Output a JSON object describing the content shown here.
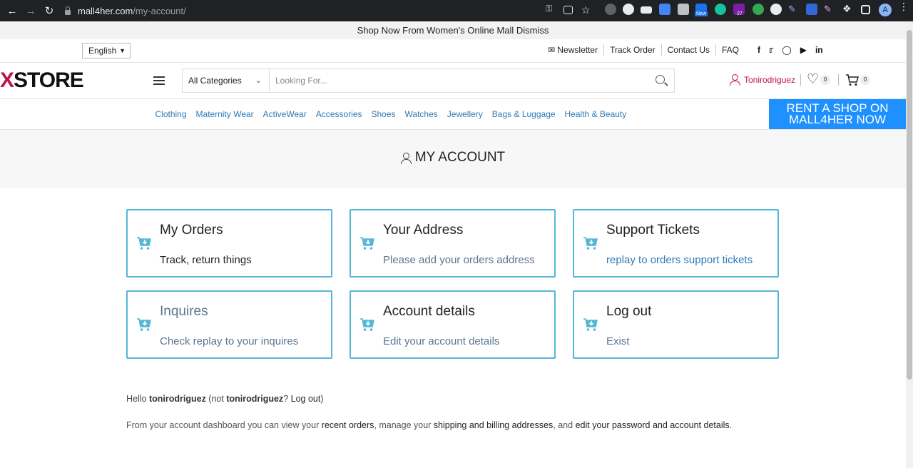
{
  "browser": {
    "url_host": "mall4her.com",
    "url_path": "/my-account/",
    "profile_initial": "A",
    "ext_badge_new": "New",
    "ext_badge_count": "27"
  },
  "announcement": "Shop Now From Women's Online Mall Dismiss",
  "topbar": {
    "language": "English",
    "links": [
      "Newsletter",
      "Track Order",
      "Contact Us",
      "FAQ"
    ],
    "socials": [
      "f",
      "t",
      "ig",
      "yt",
      "in"
    ]
  },
  "header": {
    "logo_x": "X",
    "logo_text": "STORE",
    "search_category": "All Categories",
    "search_placeholder": "Looking For...",
    "username": "Tonirodriguez",
    "wishlist_count": "0",
    "cart_count": "0"
  },
  "categories": [
    "Clothing",
    "Maternity Wear",
    "ActiveWear",
    "Accessories",
    "Shoes",
    "Watches",
    "Jewellery",
    "Bags & Luggage",
    "Health & Beauty"
  ],
  "rent_banner": {
    "line1": "RENT A SHOP ON",
    "line2": "MALL4HER NOW"
  },
  "page_title": "MY ACCOUNT",
  "cards": [
    {
      "title": "My Orders",
      "subtitle": "Track, return things"
    },
    {
      "title": "Your Address",
      "subtitle": "Please add your orders address"
    },
    {
      "title": "Support Tickets",
      "subtitle": "replay to orders support tickets"
    },
    {
      "title": "Inquires",
      "subtitle": "Check replay to your inquires"
    },
    {
      "title": "Account details",
      "subtitle": "Edit your account details"
    },
    {
      "title": "Log out",
      "subtitle": "Exist"
    }
  ],
  "account": {
    "hello_prefix": "Hello ",
    "hello_user": "tonirodriguez",
    "hello_not": " (not ",
    "hello_user2": "tonirodriguez",
    "hello_q": "? ",
    "hello_logout": "Log out",
    "hello_end": ")",
    "dash_1": "From your account dashboard you can view your ",
    "dash_recent": "recent orders",
    "dash_2": ", manage your ",
    "dash_addresses": "shipping and billing addresses",
    "dash_3": ", and ",
    "dash_edit": "edit your password and account details",
    "dash_4": "."
  }
}
